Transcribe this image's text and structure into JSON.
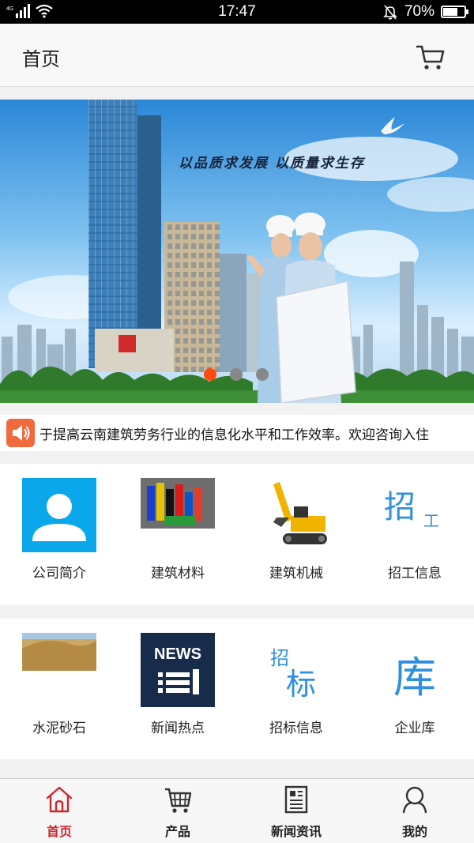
{
  "status_bar": {
    "network": "4G",
    "time": "17:47",
    "battery": "70%",
    "battery_level": 0.7
  },
  "header": {
    "title": "首页",
    "cart_icon": "cart-icon"
  },
  "banner": {
    "slogan": "以品质求发展 以质量求生存",
    "slide_count": 3,
    "active_slide": 1
  },
  "notice": {
    "icon": "speaker-icon",
    "text": "于提高云南建筑劳务行业的信息化水平和工作效率。欢迎咨询入住"
  },
  "categories": [
    {
      "label": "公司简介",
      "icon": "company-profile-icon"
    },
    {
      "label": "建筑材料",
      "icon": "building-materials-icon"
    },
    {
      "label": "建筑机械",
      "icon": "excavator-icon"
    },
    {
      "label": "招工信息",
      "icon": "recruitment-icon",
      "glyphs": [
        "招",
        "工"
      ]
    },
    {
      "label": "水泥砂石",
      "icon": "sand-gravel-icon"
    },
    {
      "label": "新闻热点",
      "icon": "news-icon",
      "glyphs": [
        "NEWS"
      ]
    },
    {
      "label": "招标信息",
      "icon": "tender-icon",
      "glyphs": [
        "招",
        "标"
      ]
    },
    {
      "label": "企业库",
      "icon": "enterprise-library-icon",
      "glyphs": [
        "库"
      ]
    }
  ],
  "bottom_nav": [
    {
      "label": "首页",
      "icon": "home-icon",
      "active": true
    },
    {
      "label": "产品",
      "icon": "shopping-cart-icon",
      "active": false
    },
    {
      "label": "新闻资讯",
      "icon": "newspaper-icon",
      "active": false
    },
    {
      "label": "我的",
      "icon": "user-icon",
      "active": false
    }
  ],
  "colors": {
    "accent": "#d0262b",
    "dot_active": "#ff4a12",
    "tile_blue": "#0aa8ea",
    "news_navy": "#172b4a"
  }
}
